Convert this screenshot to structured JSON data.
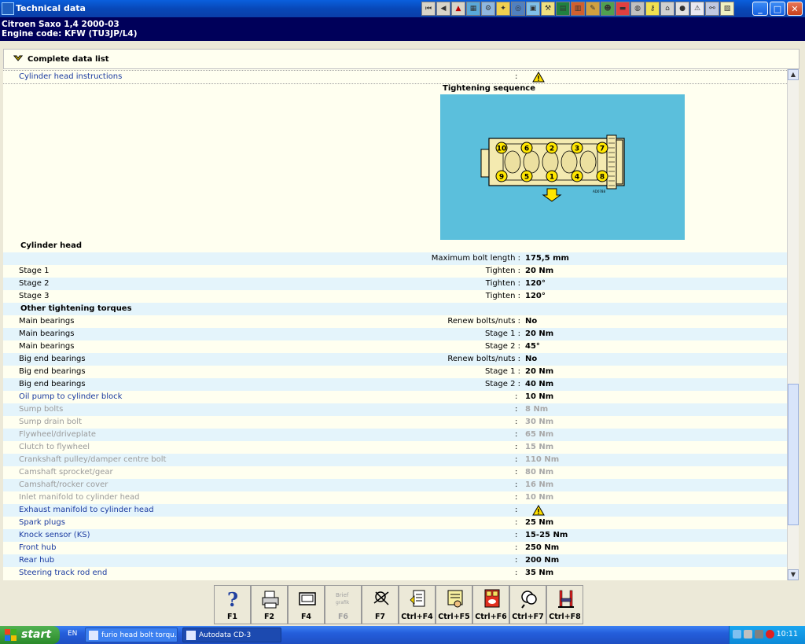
{
  "window": {
    "title": "Technical data"
  },
  "vehicle": {
    "line1": "Citroen   Saxo  1,4  2000-03",
    "line2": "Engine code: KFW (TU3JP/L4)"
  },
  "panel": {
    "header": "Complete data list"
  },
  "instructions_row": {
    "label": "Cylinder head instructions",
    "sep": ":"
  },
  "diagram": {
    "title": "Tightening sequence",
    "top_bolts": [
      "10",
      "6",
      "2",
      "3",
      "7"
    ],
    "bottom_bolts": [
      "9",
      "5",
      "1",
      "4",
      "8"
    ],
    "code": "AD0788"
  },
  "rows": [
    {
      "label": "Cylinder head",
      "sub": "",
      "sep": "",
      "value": ""
    },
    {
      "label": "",
      "sub": "Maximum bolt length :",
      "sep": "",
      "value": "175,5 mm"
    },
    {
      "label": "Stage 1",
      "sub": "Tighten :",
      "sep": "",
      "value": "20 Nm"
    },
    {
      "label": "Stage 2",
      "sub": "Tighten :",
      "sep": "",
      "value": "120°"
    },
    {
      "label": "Stage 3",
      "sub": "Tighten :",
      "sep": "",
      "value": "120°"
    },
    {
      "label": "Other tightening torques",
      "sub": "",
      "sep": "",
      "value": ""
    },
    {
      "label": "Main bearings",
      "sub": "Renew bolts/nuts :",
      "sep": "",
      "value": "No"
    },
    {
      "label": "Main bearings",
      "sub": "Stage 1 :",
      "sep": "",
      "value": "20 Nm"
    },
    {
      "label": "Main bearings",
      "sub": "Stage 2 :",
      "sep": "",
      "value": "45°"
    },
    {
      "label": "Big end bearings",
      "sub": "Renew bolts/nuts :",
      "sep": "",
      "value": "No"
    },
    {
      "label": "Big end bearings",
      "sub": "Stage 1 :",
      "sep": "",
      "value": "20 Nm"
    },
    {
      "label": "Big end bearings",
      "sub": "Stage 2 :",
      "sep": "",
      "value": "40 Nm"
    },
    {
      "label": "Oil pump to cylinder block",
      "sub": "",
      "sep": ":",
      "value": "10 Nm"
    },
    {
      "label": "Sump bolts",
      "sub": "",
      "sep": ":",
      "value": "8 Nm"
    },
    {
      "label": "Sump drain bolt",
      "sub": "",
      "sep": ":",
      "value": "30 Nm"
    },
    {
      "label": "Flywheel/driveplate",
      "sub": "",
      "sep": ":",
      "value": "65 Nm"
    },
    {
      "label": "Clutch to flywheel",
      "sub": "",
      "sep": ":",
      "value": "15 Nm"
    },
    {
      "label": "Crankshaft pulley/damper centre bolt",
      "sub": "",
      "sep": ":",
      "value": "110 Nm"
    },
    {
      "label": "Camshaft sprocket/gear",
      "sub": "",
      "sep": ":",
      "value": "80 Nm"
    },
    {
      "label": "Camshaft/rocker cover",
      "sub": "",
      "sep": ":",
      "value": "16 Nm"
    },
    {
      "label": "Inlet manifold to cylinder head",
      "sub": "",
      "sep": ":",
      "value": "10 Nm"
    },
    {
      "label": "Exhaust manifold to cylinder head",
      "sub": "",
      "sep": ":",
      "value": ""
    },
    {
      "label": "Spark plugs",
      "sub": "",
      "sep": ":",
      "value": "25 Nm"
    },
    {
      "label": "Knock sensor (KS)",
      "sub": "",
      "sep": ":",
      "value": "15-25 Nm"
    },
    {
      "label": "Front hub",
      "sub": "",
      "sep": ":",
      "value": "250 Nm"
    },
    {
      "label": "Rear hub",
      "sub": "",
      "sep": ":",
      "value": "200 Nm"
    },
    {
      "label": "Steering track rod end",
      "sub": "",
      "sep": ":",
      "value": "35 Nm"
    }
  ],
  "fkeys": [
    {
      "label": "F1",
      "icon": "help-icon"
    },
    {
      "label": "F2",
      "icon": "print-icon"
    },
    {
      "label": "F4",
      "icon": "screen-icon"
    },
    {
      "label": "F6",
      "icon": "brief-icon"
    },
    {
      "label": "F7",
      "icon": "tools-icon"
    },
    {
      "label": "Ctrl+F4",
      "icon": "document-icon"
    },
    {
      "label": "Ctrl+F5",
      "icon": "hand-list-icon"
    },
    {
      "label": "Ctrl+F6",
      "icon": "calculator-icon"
    },
    {
      "label": "Ctrl+F7",
      "icon": "magnifier-icon"
    },
    {
      "label": "Ctrl+F8",
      "icon": "lift-icon"
    }
  ],
  "fkey_f6_logo": "Brief\ngrafik",
  "taskbar": {
    "start": "start",
    "lang": "EN",
    "task1": "furio head bolt torqu...",
    "task2": "Autodata CD-3",
    "clock": "10:11"
  },
  "colors": {
    "title_blue": "#0a5fdd",
    "vehicle_bar": "#00005a",
    "content_bg": "#fffff0",
    "stripe": "#e4f4fb",
    "diagram_bg": "#5bbfdc"
  }
}
